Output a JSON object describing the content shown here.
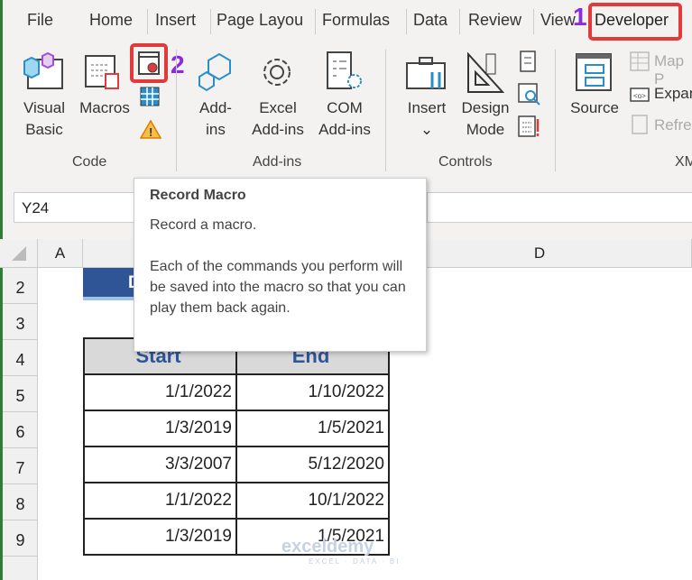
{
  "tabs": [
    "File",
    "Home",
    "Insert",
    "Page Layou",
    "Formulas",
    "Data",
    "Review",
    "View",
    "Developer"
  ],
  "annotations": {
    "step1": "1",
    "step2": "2"
  },
  "ribbon": {
    "code": {
      "label": "Code",
      "visual_basic": [
        "Visual",
        "Basic"
      ],
      "macros": "Macros"
    },
    "addins": {
      "label": "Add-ins",
      "addins": [
        "Add-",
        "ins"
      ],
      "excel_addins": [
        "Excel",
        "Add-ins"
      ],
      "com_addins": [
        "COM",
        "Add-ins"
      ]
    },
    "controls": {
      "label": "Controls",
      "insert": "Insert",
      "design_mode": [
        "Design",
        "Mode"
      ]
    },
    "xml": {
      "label": "XM",
      "source": "Source",
      "map": "Map P",
      "expand": "Expan",
      "refresh": "Refres"
    }
  },
  "name_box": "Y24",
  "columns": [
    "A",
    "D"
  ],
  "rows": [
    "2",
    "3",
    "4",
    "5",
    "6",
    "7",
    "8",
    "9"
  ],
  "table": {
    "headers": [
      "Start",
      "End"
    ],
    "rows": [
      [
        "1/1/2022",
        "1/10/2022"
      ],
      [
        "1/3/2019",
        "1/5/2021"
      ],
      [
        "3/3/2007",
        "5/12/2020"
      ],
      [
        "1/1/2022",
        "10/1/2022"
      ],
      [
        "1/3/2019",
        "1/5/2021"
      ]
    ]
  },
  "title_cell": "D",
  "tooltip": {
    "title": "Record Macro",
    "line1": "Record a macro.",
    "body": "Each of the commands you perform will be saved into the macro so that you can play them back again."
  },
  "watermark": {
    "name": "exceldemy",
    "tagline": "EXCEL · DATA · BI"
  },
  "colors": {
    "accent": "#2f5597",
    "highlight": "#e03a3a",
    "annotation": "#8a2be2"
  }
}
